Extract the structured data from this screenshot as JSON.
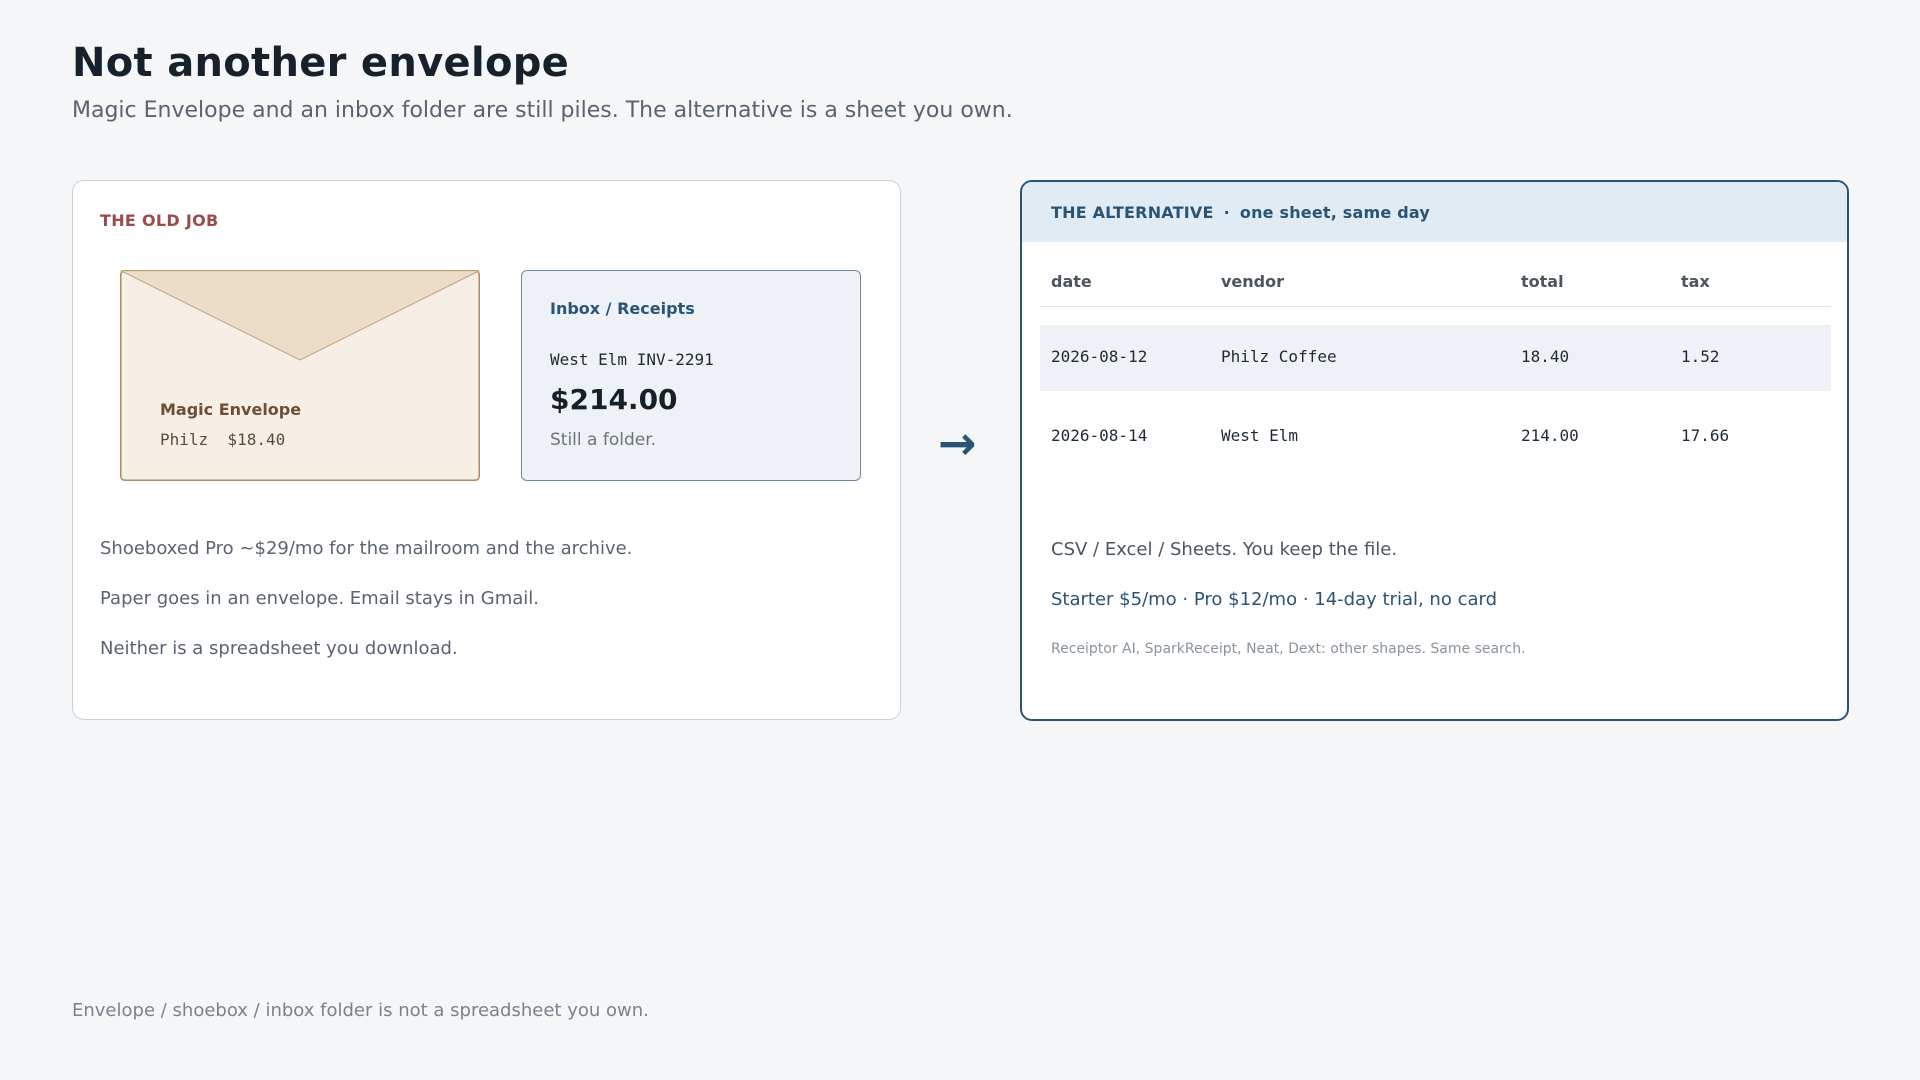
{
  "title": "Not another envelope",
  "subtitle": "Magic Envelope and an inbox folder are still piles. The alternative is a sheet you own.",
  "old_card": {
    "label": "THE OLD JOB",
    "envelope": {
      "name": "Magic Envelope",
      "line": "Philz  $18.40"
    },
    "inbox": {
      "title": "Inbox / Receipts",
      "invoice": "West Elm INV-2291",
      "amount": "$214.00",
      "note": "Still a folder."
    },
    "lines": [
      "Shoeboxed Pro ~$29/mo for the mailroom and the archive.",
      "Paper goes in an envelope. Email stays in Gmail.",
      "Neither is a spreadsheet you download."
    ]
  },
  "arrow_icon": "right-arrow",
  "alt_card": {
    "header_label": "THE ALTERNATIVE",
    "header_separator": "·",
    "header_note": "one sheet, same day",
    "columns": [
      "date",
      "vendor",
      "total",
      "tax"
    ],
    "rows": [
      [
        "2026-08-12",
        "Philz Coffee",
        "18.40",
        "1.52"
      ],
      [
        "2026-08-14",
        "West Elm",
        "214.00",
        "17.66"
      ]
    ],
    "line1": "CSV / Excel / Sheets. You keep the file.",
    "line2": "Starter $5/mo · Pro $12/mo · 14-day trial, no card",
    "line3": "Receiptor AI, SparkReceipt, Neat, Dext: other shapes. Same search."
  },
  "footer": "Envelope / shoebox / inbox folder is not a spreadsheet you own.",
  "colors": {
    "accent": "#2a5475",
    "old_label": "#9a4b4b",
    "envelope_fill": "#f6efe6",
    "envelope_flap": "#ecdcc8",
    "envelope_border": "#b08a5e"
  }
}
